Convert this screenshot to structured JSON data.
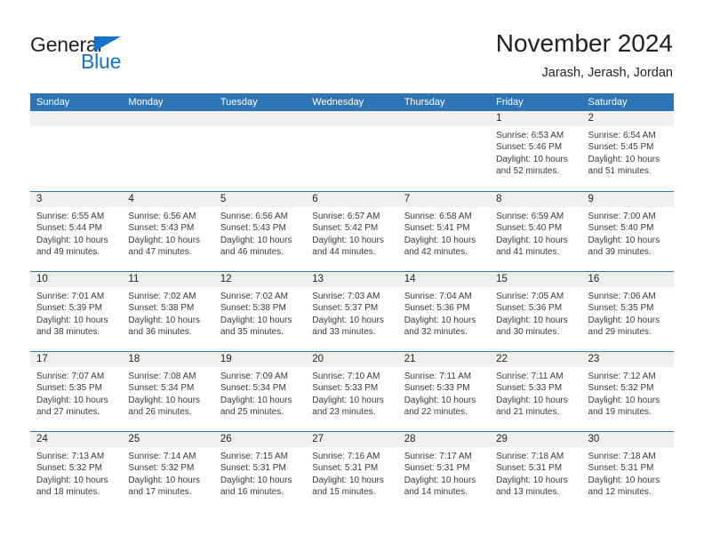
{
  "brand": {
    "name_part1": "General",
    "name_part2": "Blue",
    "logo_icon": "triangle-icon",
    "accent_color": "#1473c6"
  },
  "header": {
    "title": "November 2024",
    "subtitle": "Jarash, Jerash, Jordan"
  },
  "colors": {
    "header_blue": "#2e75b6",
    "day_band_gray": "#f0f0f0",
    "text": "#231f20"
  },
  "weekdays": [
    "Sunday",
    "Monday",
    "Tuesday",
    "Wednesday",
    "Thursday",
    "Friday",
    "Saturday"
  ],
  "weeks": [
    [
      {
        "day": "",
        "sunrise": "",
        "sunset": "",
        "daylight": "",
        "empty": true
      },
      {
        "day": "",
        "sunrise": "",
        "sunset": "",
        "daylight": "",
        "empty": true
      },
      {
        "day": "",
        "sunrise": "",
        "sunset": "",
        "daylight": "",
        "empty": true
      },
      {
        "day": "",
        "sunrise": "",
        "sunset": "",
        "daylight": "",
        "empty": true
      },
      {
        "day": "",
        "sunrise": "",
        "sunset": "",
        "daylight": "",
        "empty": true
      },
      {
        "day": "1",
        "sunrise": "Sunrise: 6:53 AM",
        "sunset": "Sunset: 5:46 PM",
        "daylight": "Daylight: 10 hours and 52 minutes."
      },
      {
        "day": "2",
        "sunrise": "Sunrise: 6:54 AM",
        "sunset": "Sunset: 5:45 PM",
        "daylight": "Daylight: 10 hours and 51 minutes."
      }
    ],
    [
      {
        "day": "3",
        "sunrise": "Sunrise: 6:55 AM",
        "sunset": "Sunset: 5:44 PM",
        "daylight": "Daylight: 10 hours and 49 minutes."
      },
      {
        "day": "4",
        "sunrise": "Sunrise: 6:56 AM",
        "sunset": "Sunset: 5:43 PM",
        "daylight": "Daylight: 10 hours and 47 minutes."
      },
      {
        "day": "5",
        "sunrise": "Sunrise: 6:56 AM",
        "sunset": "Sunset: 5:43 PM",
        "daylight": "Daylight: 10 hours and 46 minutes."
      },
      {
        "day": "6",
        "sunrise": "Sunrise: 6:57 AM",
        "sunset": "Sunset: 5:42 PM",
        "daylight": "Daylight: 10 hours and 44 minutes."
      },
      {
        "day": "7",
        "sunrise": "Sunrise: 6:58 AM",
        "sunset": "Sunset: 5:41 PM",
        "daylight": "Daylight: 10 hours and 42 minutes."
      },
      {
        "day": "8",
        "sunrise": "Sunrise: 6:59 AM",
        "sunset": "Sunset: 5:40 PM",
        "daylight": "Daylight: 10 hours and 41 minutes."
      },
      {
        "day": "9",
        "sunrise": "Sunrise: 7:00 AM",
        "sunset": "Sunset: 5:40 PM",
        "daylight": "Daylight: 10 hours and 39 minutes."
      }
    ],
    [
      {
        "day": "10",
        "sunrise": "Sunrise: 7:01 AM",
        "sunset": "Sunset: 5:39 PM",
        "daylight": "Daylight: 10 hours and 38 minutes."
      },
      {
        "day": "11",
        "sunrise": "Sunrise: 7:02 AM",
        "sunset": "Sunset: 5:38 PM",
        "daylight": "Daylight: 10 hours and 36 minutes."
      },
      {
        "day": "12",
        "sunrise": "Sunrise: 7:02 AM",
        "sunset": "Sunset: 5:38 PM",
        "daylight": "Daylight: 10 hours and 35 minutes."
      },
      {
        "day": "13",
        "sunrise": "Sunrise: 7:03 AM",
        "sunset": "Sunset: 5:37 PM",
        "daylight": "Daylight: 10 hours and 33 minutes."
      },
      {
        "day": "14",
        "sunrise": "Sunrise: 7:04 AM",
        "sunset": "Sunset: 5:36 PM",
        "daylight": "Daylight: 10 hours and 32 minutes."
      },
      {
        "day": "15",
        "sunrise": "Sunrise: 7:05 AM",
        "sunset": "Sunset: 5:36 PM",
        "daylight": "Daylight: 10 hours and 30 minutes."
      },
      {
        "day": "16",
        "sunrise": "Sunrise: 7:06 AM",
        "sunset": "Sunset: 5:35 PM",
        "daylight": "Daylight: 10 hours and 29 minutes."
      }
    ],
    [
      {
        "day": "17",
        "sunrise": "Sunrise: 7:07 AM",
        "sunset": "Sunset: 5:35 PM",
        "daylight": "Daylight: 10 hours and 27 minutes."
      },
      {
        "day": "18",
        "sunrise": "Sunrise: 7:08 AM",
        "sunset": "Sunset: 5:34 PM",
        "daylight": "Daylight: 10 hours and 26 minutes."
      },
      {
        "day": "19",
        "sunrise": "Sunrise: 7:09 AM",
        "sunset": "Sunset: 5:34 PM",
        "daylight": "Daylight: 10 hours and 25 minutes."
      },
      {
        "day": "20",
        "sunrise": "Sunrise: 7:10 AM",
        "sunset": "Sunset: 5:33 PM",
        "daylight": "Daylight: 10 hours and 23 minutes."
      },
      {
        "day": "21",
        "sunrise": "Sunrise: 7:11 AM",
        "sunset": "Sunset: 5:33 PM",
        "daylight": "Daylight: 10 hours and 22 minutes."
      },
      {
        "day": "22",
        "sunrise": "Sunrise: 7:11 AM",
        "sunset": "Sunset: 5:33 PM",
        "daylight": "Daylight: 10 hours and 21 minutes."
      },
      {
        "day": "23",
        "sunrise": "Sunrise: 7:12 AM",
        "sunset": "Sunset: 5:32 PM",
        "daylight": "Daylight: 10 hours and 19 minutes."
      }
    ],
    [
      {
        "day": "24",
        "sunrise": "Sunrise: 7:13 AM",
        "sunset": "Sunset: 5:32 PM",
        "daylight": "Daylight: 10 hours and 18 minutes."
      },
      {
        "day": "25",
        "sunrise": "Sunrise: 7:14 AM",
        "sunset": "Sunset: 5:32 PM",
        "daylight": "Daylight: 10 hours and 17 minutes."
      },
      {
        "day": "26",
        "sunrise": "Sunrise: 7:15 AM",
        "sunset": "Sunset: 5:31 PM",
        "daylight": "Daylight: 10 hours and 16 minutes."
      },
      {
        "day": "27",
        "sunrise": "Sunrise: 7:16 AM",
        "sunset": "Sunset: 5:31 PM",
        "daylight": "Daylight: 10 hours and 15 minutes."
      },
      {
        "day": "28",
        "sunrise": "Sunrise: 7:17 AM",
        "sunset": "Sunset: 5:31 PM",
        "daylight": "Daylight: 10 hours and 14 minutes."
      },
      {
        "day": "29",
        "sunrise": "Sunrise: 7:18 AM",
        "sunset": "Sunset: 5:31 PM",
        "daylight": "Daylight: 10 hours and 13 minutes."
      },
      {
        "day": "30",
        "sunrise": "Sunrise: 7:18 AM",
        "sunset": "Sunset: 5:31 PM",
        "daylight": "Daylight: 10 hours and 12 minutes."
      }
    ]
  ]
}
